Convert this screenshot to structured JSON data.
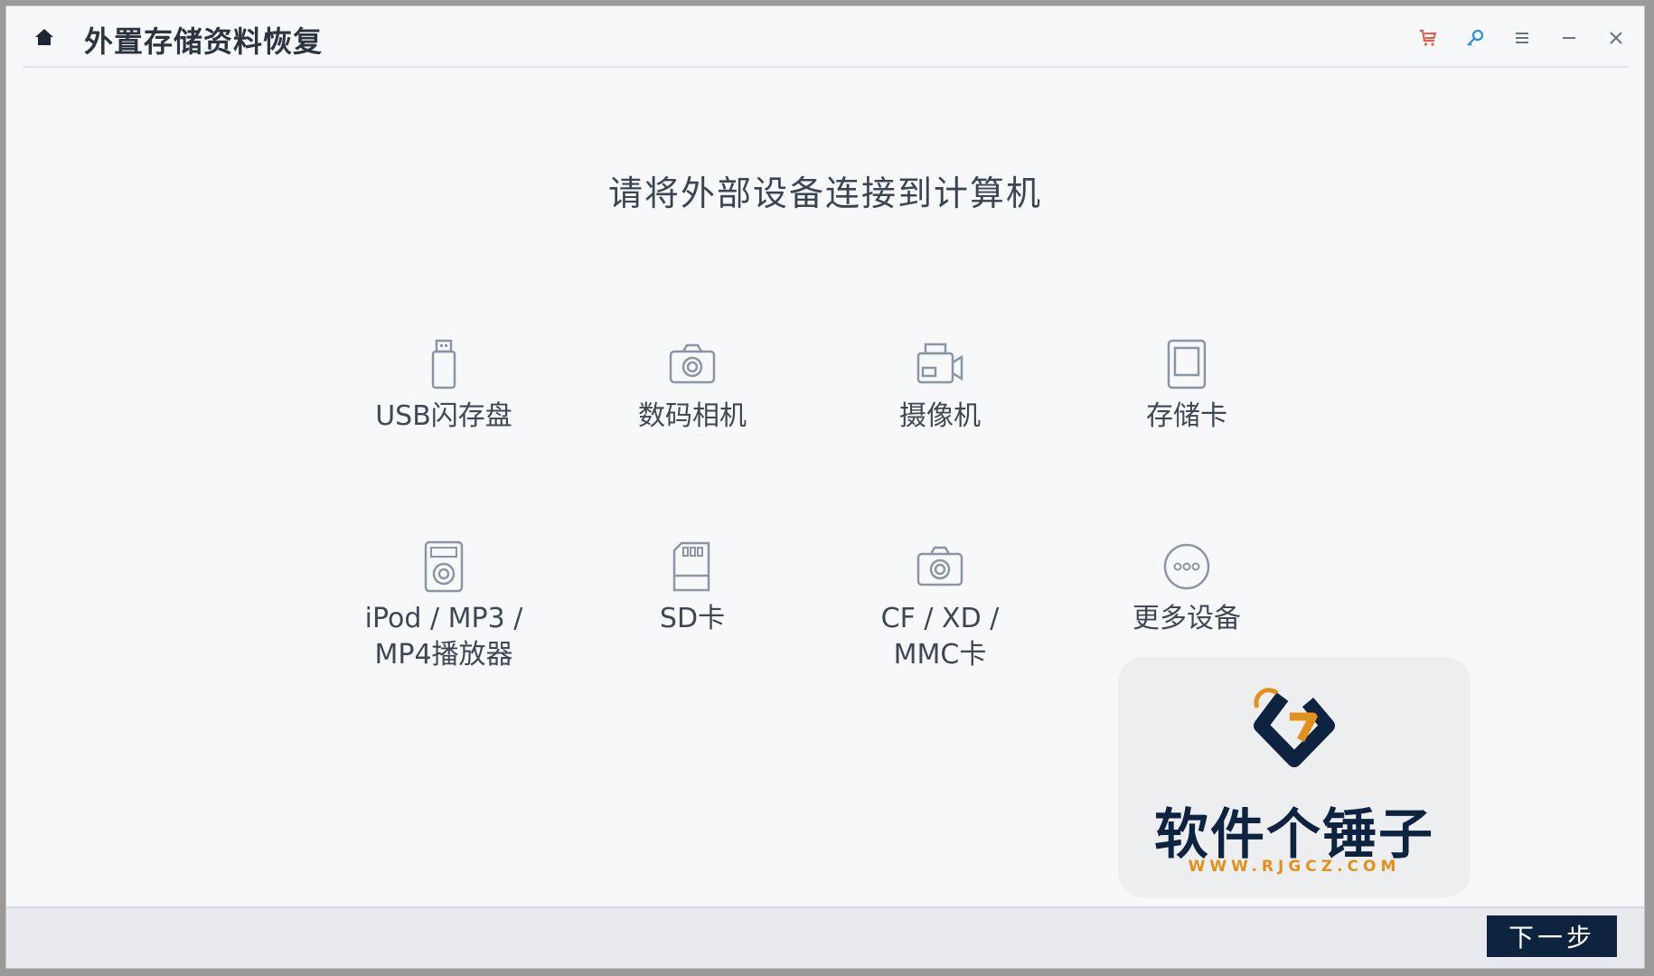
{
  "window": {
    "title": "外置存储资料恢复",
    "icons": {
      "home": "home-icon",
      "cart": "cart-icon",
      "key": "key-icon",
      "menu": "menu-icon",
      "minimize": "minimize-icon",
      "close": "close-icon"
    },
    "colors": {
      "cart": "#e05c4f",
      "key": "#2f8fd8",
      "controls": "#6a7380"
    }
  },
  "main": {
    "headline": "请将外部设备连接到计算机",
    "devices": [
      {
        "label": "USB闪存盘",
        "icon": "usb-drive-icon"
      },
      {
        "label": "数码相机",
        "icon": "camera-icon"
      },
      {
        "label": "摄像机",
        "icon": "video-camera-icon"
      },
      {
        "label": "存储卡",
        "icon": "memory-card-icon"
      },
      {
        "label": "iPod / MP3 /\nMP4播放器",
        "icon": "media-player-icon"
      },
      {
        "label": "SD卡",
        "icon": "sd-card-icon"
      },
      {
        "label": "CF / XD /\nMMC卡",
        "icon": "cf-card-icon"
      },
      {
        "label": "更多设备",
        "icon": "more-devices-icon"
      }
    ]
  },
  "footer": {
    "next_label": "下一步",
    "accent": "#0d2340"
  },
  "watermark": {
    "name": "软件个锤子",
    "url": "WWW.RJGCZ.COM"
  }
}
